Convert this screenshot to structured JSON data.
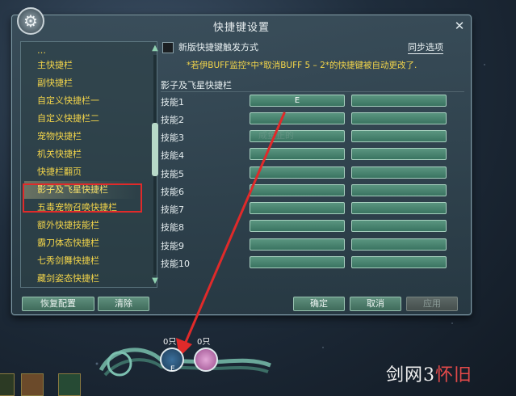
{
  "window": {
    "title": "快捷键设置",
    "close": "✕",
    "gear_glyph": "⚙"
  },
  "left_list": {
    "items": [
      {
        "label": "主快捷栏"
      },
      {
        "label": "副快捷栏"
      },
      {
        "label": "自定义快捷栏一"
      },
      {
        "label": "自定义快捷栏二"
      },
      {
        "label": "宠物快捷栏"
      },
      {
        "label": "机关快捷栏"
      },
      {
        "label": "快捷栏翻页"
      },
      {
        "label": "影子及飞星快捷栏"
      },
      {
        "label": "五毒宠物召唤快捷栏"
      },
      {
        "label": "额外快捷技能栏"
      },
      {
        "label": "霸刀体态快捷栏"
      },
      {
        "label": "七秀剑舞快捷栏"
      },
      {
        "label": "藏剑姿态快捷栏"
      }
    ],
    "selected_index": 7,
    "scroll_up": "▲",
    "scroll_down": "▼"
  },
  "buttons": {
    "restore": "恢复配置",
    "clear": "清除",
    "ok": "确定",
    "cancel": "取消",
    "apply": "应用"
  },
  "options": {
    "new_trigger_label": "新版快捷键触发方式",
    "sync_label": "同步选项"
  },
  "notice": "*若伊BUFF监控*中*取消BUFF 5 – 2*的快捷键被自动更改了.",
  "section": {
    "label": "影子及飞星快捷栏",
    "skills": [
      {
        "label": "技能1",
        "key1": "E",
        "key2": ""
      },
      {
        "label": "技能2",
        "key1": "",
        "key2": ""
      },
      {
        "label": "技能3",
        "key1": "",
        "key2": ""
      },
      {
        "label": "技能4",
        "key1": "",
        "key2": ""
      },
      {
        "label": "技能5",
        "key1": "",
        "key2": ""
      },
      {
        "label": "技能6",
        "key1": "",
        "key2": ""
      },
      {
        "label": "技能7",
        "key1": "",
        "key2": ""
      },
      {
        "label": "技能8",
        "key1": "",
        "key2": ""
      },
      {
        "label": "技能9",
        "key1": "",
        "key2": ""
      },
      {
        "label": "技能10",
        "key1": "",
        "key2": ""
      }
    ]
  },
  "watermark": "咸鱼正的",
  "hud": {
    "slot1_count": "0只",
    "slot2_count": "0只",
    "slot1_key": "E"
  },
  "logo": {
    "main": "剑网3",
    "tail": "怀旧"
  },
  "colors": {
    "highlight_box": "#e02a2a",
    "arrow": "#e02a2a",
    "list_text": "#f3d54a",
    "key_field": "#4a8570"
  }
}
